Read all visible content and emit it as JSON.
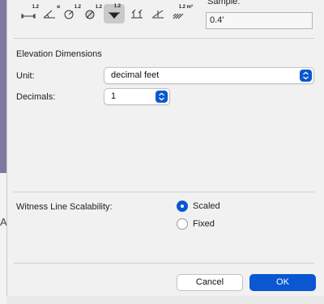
{
  "background_mark": "A",
  "toolbar": {
    "tools": [
      {
        "icon": "linear-dimension-icon",
        "glyph": "↔",
        "tag": "1.2"
      },
      {
        "icon": "angular-dimension-icon",
        "glyph": "∠",
        "tag": "α"
      },
      {
        "icon": "radial-dimension-icon",
        "glyph": "⊕",
        "tag": "1.2"
      },
      {
        "icon": "diameter-dimension-icon",
        "glyph": "⊘",
        "tag": "1.2"
      },
      {
        "icon": "elevation-dimension-icon",
        "glyph": "▼",
        "tag": "1.2"
      },
      {
        "icon": "level-dimension-icon",
        "glyph": "⏚",
        "tag": ""
      },
      {
        "icon": "slope-dimension-icon",
        "glyph": "∕",
        "tag": ""
      },
      {
        "icon": "area-dimension-icon",
        "glyph": "▨",
        "tag": "1.2 m²"
      }
    ]
  },
  "sample": {
    "label": "Sample:",
    "value": "0.4'"
  },
  "section": {
    "title": "Elevation Dimensions"
  },
  "unit": {
    "label": "Unit:",
    "value": "decimal feet"
  },
  "decimals": {
    "label": "Decimals:",
    "value": "1"
  },
  "witness": {
    "label": "Witness Line Scalability:",
    "options": [
      {
        "label": "Scaled",
        "selected": true
      },
      {
        "label": "Fixed",
        "selected": false
      }
    ]
  },
  "buttons": {
    "cancel": "Cancel",
    "ok": "OK"
  },
  "colors": {
    "accent": "#0a57d1",
    "panel": "#f1f1f1"
  }
}
